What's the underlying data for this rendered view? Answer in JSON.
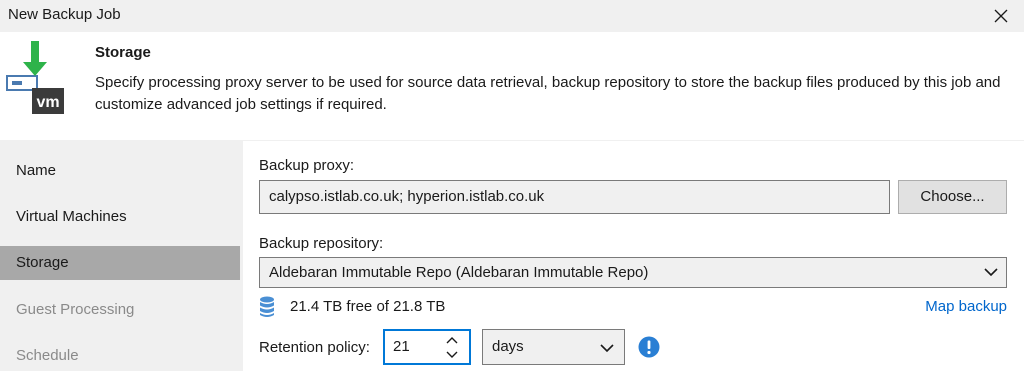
{
  "window": {
    "title": "New Backup Job"
  },
  "header": {
    "step_title": "Storage",
    "description": "Specify processing proxy server to be used for source data retrieval, backup repository to store the backup files produced by this job and customize advanced job settings if required."
  },
  "sidebar": {
    "items": [
      {
        "label": "Name",
        "state": "normal"
      },
      {
        "label": "Virtual Machines",
        "state": "normal"
      },
      {
        "label": "Storage",
        "state": "active"
      },
      {
        "label": "Guest Processing",
        "state": "disabled"
      },
      {
        "label": "Schedule",
        "state": "disabled"
      }
    ]
  },
  "form": {
    "proxy_label": "Backup proxy:",
    "proxy_value": "calypso.istlab.co.uk; hyperion.istlab.co.uk",
    "choose_label": "Choose...",
    "repo_label": "Backup repository:",
    "repo_value": "Aldebaran Immutable Repo (Aldebaran Immutable Repo)",
    "free_space": "21.4 TB free of 21.8 TB",
    "map_backup_label": "Map backup",
    "retention_label": "Retention policy:",
    "retention_value": "21",
    "retention_unit": "days"
  },
  "colors": {
    "accent": "#0078d7",
    "link": "#0066cc",
    "icon_green": "#2eb34a",
    "nav_active": "#a8a8a8",
    "panel_gray": "#f0f0f0"
  },
  "icons": [
    "close-icon",
    "vm-storage-icon",
    "database-icon",
    "chevron-down-icon",
    "spin-up-icon",
    "spin-down-icon",
    "info-icon"
  ]
}
